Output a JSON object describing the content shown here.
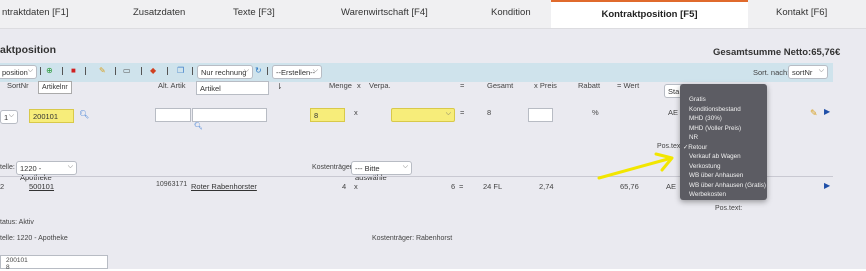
{
  "tabs": [
    {
      "label": "ntraktdaten [F1]"
    },
    {
      "label": "Zusatzdaten"
    },
    {
      "label": "Texte [F3]"
    },
    {
      "label": "Warenwirtschaft [F4]"
    },
    {
      "label": "Kondition"
    },
    {
      "label": "Kontraktposition [F5]"
    },
    {
      "label": "Kontakt [F6]"
    }
  ],
  "page": {
    "title": "aktposition",
    "total": "Gesamtsumme Netto:65,76€"
  },
  "toolbar": {
    "position_select": "position",
    "tooltip": "Artikelnr",
    "rechnung_select": "Nur rechnung",
    "erstellen_select": "--Erstellen--",
    "sort_label": "Sort. nach:",
    "sort_select": "sortNr",
    "partial_label": "e S"
  },
  "columns": {
    "sortnr": "SortNr",
    "alt_artik": "Alt. Artik",
    "artikel": "Artikel",
    "menge": "Menge",
    "x1": "x",
    "verpa": "Verpa.",
    "eq1": "=",
    "gesamt": "Gesamt",
    "x_preis": "x Preis",
    "rabatt": "Rabatt",
    "wert": "= Wert",
    "sta": "Sta"
  },
  "edit_row": {
    "sort_select": "1",
    "artikelnr": "200101",
    "menge": "8",
    "x": "x",
    "eq": "=",
    "gesamt": "8",
    "percent": "%",
    "ae": "AE",
    "pos_text": "Pos.text",
    "stelle_label": "telle:",
    "stelle_select": "1220 - Apotheke",
    "kostentraeger_label": "Kostenträger:",
    "kostentraeger_select": "--- Bitte auswähle"
  },
  "item_row": {
    "nr": "2",
    "artikelnr": "500101",
    "alt_artik": "10963171",
    "artikel": "Roter Rabenhorster",
    "menge": "4",
    "x": "x",
    "verpa": "6",
    "eq": "=",
    "gesamt": "24 FL",
    "preis": "2,74",
    "wert": "65,76",
    "ae": "AE",
    "pos_text": "Pos.text:",
    "status": "tatus: Aktiv",
    "stelle": "telle: 1220 - Apotheke",
    "kostentraeger": "Kostenträger: Rabenhorst"
  },
  "bottom_field": {
    "line1": "200101",
    "line2": "8"
  },
  "popup": {
    "options": [
      {
        "label": "Gratis",
        "checked": false
      },
      {
        "label": "Konditionsbestand",
        "checked": false
      },
      {
        "label": "MHD (30%)",
        "checked": false
      },
      {
        "label": "MHD (Voller Preis)",
        "checked": false
      },
      {
        "label": "NR",
        "checked": false
      },
      {
        "label": "Retour",
        "checked": true
      },
      {
        "label": "Verkauf ab Wagen",
        "checked": false
      },
      {
        "label": "Verkostung",
        "checked": false
      },
      {
        "label": "WB über Anhausen",
        "checked": false
      },
      {
        "label": "WB über Anhausen (Gratis)",
        "checked": false
      },
      {
        "label": "Werbekosten",
        "checked": false
      }
    ]
  },
  "colors": {
    "accent_tab": "#e06a2c",
    "toolbar_bg": "#cfe3ec",
    "input_yellow": "#f7ed7a",
    "annotation_arrow": "#f2e600",
    "link_blue": "#1f4fa8",
    "popup_bg": "#5c5c63"
  }
}
